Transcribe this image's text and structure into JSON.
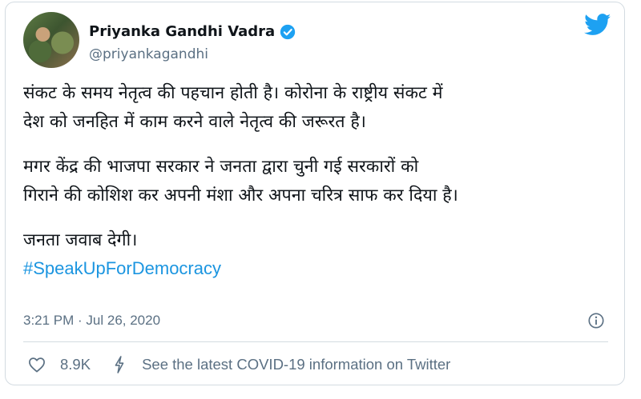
{
  "tweet": {
    "author_name": "Priyanka Gandhi Vadra",
    "handle": "@priyankagandhi",
    "paragraphs": [
      "संकट के समय नेतृत्व की पहचान होती है। कोरोना के राष्ट्रीय संकट में\nदेश को जनहित में काम करने वाले नेतृत्व की जरूरत है।",
      "मगर केंद्र की भाजपा सरकार ने जनता द्वारा चुनी गई सरकारों को\nगिराने की कोशिश कर अपनी मंशा और अपना चरित्र साफ कर दिया है।",
      "जनता जवाब देगी।"
    ],
    "hashtag": "#SpeakUpForDemocracy",
    "timestamp": "3:21 PM · Jul 26, 2020",
    "like_count": "8.9K",
    "covid_link": "See the latest COVID-19 information on Twitter"
  },
  "icons": {
    "verified": "verified-badge-icon",
    "bird": "twitter-bird-icon",
    "info": "info-icon",
    "like": "heart-icon",
    "covid": "lightning-bolt-icon"
  },
  "colors": {
    "link": "#1b95e0",
    "twitter_blue": "#1da1f2",
    "secondary_text": "#5b7083",
    "border": "#d3dbe1"
  }
}
